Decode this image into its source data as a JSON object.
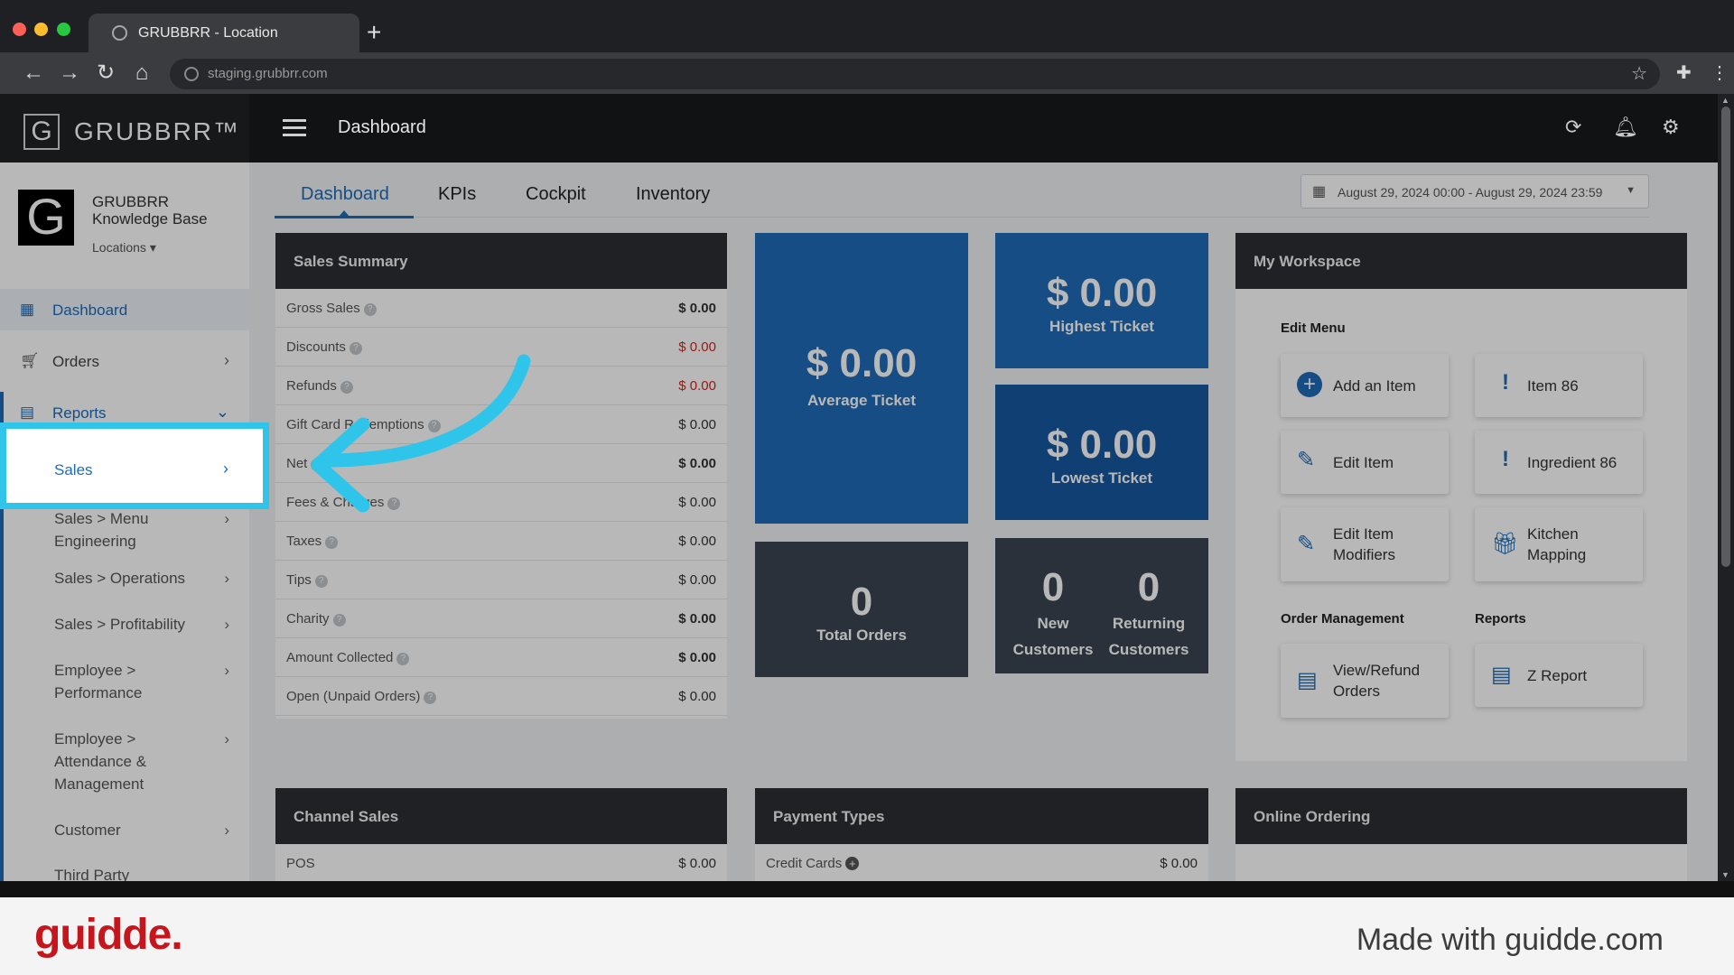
{
  "browser": {
    "tab_title": "GRUBBRR - Location",
    "url": "staging.grubbrr.com"
  },
  "header": {
    "logo_letter": "G",
    "logo_text": "GRUBBRR™",
    "title": "Dashboard"
  },
  "sidebar": {
    "org_letter": "G",
    "org_name": "GRUBBRR Knowledge Base",
    "locations_label": "Locations",
    "items": [
      {
        "label": "Dashboard",
        "icon": "dashboard-icon"
      },
      {
        "label": "Orders",
        "icon": "cart-icon"
      },
      {
        "label": "Reports",
        "icon": "report-icon"
      }
    ],
    "sub_items": [
      "Sales",
      "Sales > Menu Engineering",
      "Sales > Operations",
      "Sales > Profitability",
      "Employee > Performance",
      "Employee > Attendance & Management",
      "Customer",
      "Third Party"
    ]
  },
  "tabs": [
    "Dashboard",
    "KPIs",
    "Cockpit",
    "Inventory"
  ],
  "date_range": "August 29, 2024 00:00 - August 29, 2024 23:59",
  "sales_summary": {
    "title": "Sales Summary",
    "rows": [
      {
        "label": "Gross Sales",
        "value": "$ 0.00",
        "style": "bold"
      },
      {
        "label": "Discounts",
        "value": "$ 0.00",
        "style": "red"
      },
      {
        "label": "Refunds",
        "value": "$ 0.00",
        "style": "red"
      },
      {
        "label": "Gift Card Redemptions",
        "value": "$ 0.00",
        "style": "normal"
      },
      {
        "label": "Net",
        "value": "$ 0.00",
        "style": "bold"
      },
      {
        "label": "Fees & Charges",
        "value": "$ 0.00",
        "style": "normal"
      },
      {
        "label": "Taxes",
        "value": "$ 0.00",
        "style": "normal"
      },
      {
        "label": "Tips",
        "value": "$ 0.00",
        "style": "normal"
      },
      {
        "label": "Charity",
        "value": "$ 0.00",
        "style": "bold"
      },
      {
        "label": "Amount Collected",
        "value": "$ 0.00",
        "style": "bold"
      },
      {
        "label": "Open (Unpaid Orders)",
        "value": "$ 0.00",
        "style": "normal"
      }
    ]
  },
  "tiles": {
    "average_ticket": {
      "value": "$ 0.00",
      "label": "Average Ticket"
    },
    "highest_ticket": {
      "value": "$ 0.00",
      "label": "Highest Ticket"
    },
    "lowest_ticket": {
      "value": "$ 0.00",
      "label": "Lowest Ticket"
    },
    "total_orders": {
      "value": "0",
      "label": "Total Orders"
    },
    "new_customers": {
      "value": "0",
      "label": "New Customers"
    },
    "returning_customers": {
      "value": "0",
      "label": "Returning Customers"
    }
  },
  "workspace": {
    "title": "My Workspace",
    "edit_menu_label": "Edit Menu",
    "order_mgmt_label": "Order Management",
    "reports_label": "Reports",
    "buttons": {
      "add_item": "Add an Item",
      "item_86": "Item 86",
      "edit_item": "Edit Item",
      "ingredient_86": "Ingredient 86",
      "edit_item_modifiers": "Edit Item Modifiers",
      "kitchen_mapping": "Kitchen Mapping",
      "view_refund_orders": "View/Refund Orders",
      "z_report": "Z Report"
    }
  },
  "bottom_panels": {
    "channel_sales": {
      "title": "Channel Sales",
      "row_label": "POS",
      "row_value": "$ 0.00"
    },
    "payment_types": {
      "title": "Payment Types",
      "row_label": "Credit Cards",
      "row_value": "$ 0.00"
    },
    "online_ordering": {
      "title": "Online Ordering"
    }
  },
  "footer": {
    "brand": "guidde.",
    "made_with": "Made with guidde.com"
  },
  "colors": {
    "accent": "#1e6bb8",
    "highlight": "#2fc4ea",
    "tile_blue": "#1e6bb8",
    "tile_dark_blue": "#1558a0",
    "tile_dark": "#3c4552",
    "negative": "#d9231d"
  }
}
